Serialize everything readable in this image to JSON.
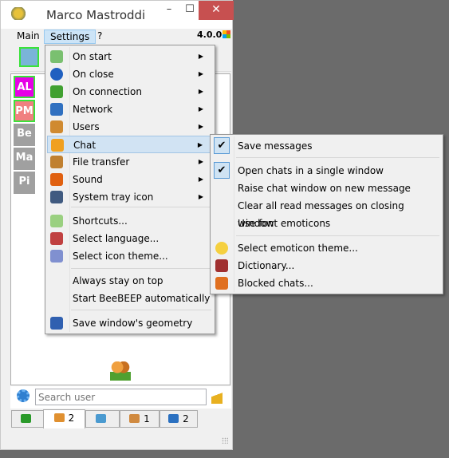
{
  "window": {
    "title": "Marco Mastroddi",
    "version": "4.0.0",
    "minimize": "–",
    "maximize": "☐",
    "close": "✕"
  },
  "menubar": [
    "Main",
    "Settings",
    "?"
  ],
  "users": [
    {
      "initials": "AL",
      "color": "#e600e6",
      "border": "#3ae23a"
    },
    {
      "initials": "PM",
      "color": "#f08080",
      "border": "#3ae23a"
    },
    {
      "initials": "Be",
      "color": "#a0a0a0"
    },
    {
      "initials": "Ma",
      "color": "#a0a0a0"
    },
    {
      "initials": "Pi",
      "color": "#a0a0a0"
    }
  ],
  "search": {
    "placeholder": "Search user"
  },
  "tabs": [
    {
      "icon": "monitor-icon",
      "count": ""
    },
    {
      "icon": "users-icon",
      "count": "2"
    },
    {
      "icon": "chat-bubbles-icon",
      "count": ""
    },
    {
      "icon": "groups-icon",
      "count": "1"
    },
    {
      "icon": "share-icon",
      "count": "2"
    }
  ],
  "settings_menu": {
    "submenus": [
      {
        "label": "On start",
        "icon": "gear-icon"
      },
      {
        "label": "On close",
        "icon": "power-icon"
      },
      {
        "label": "On connection",
        "icon": "connection-icon"
      },
      {
        "label": "Network",
        "icon": "network-icon"
      },
      {
        "label": "Users",
        "icon": "users-icon"
      },
      {
        "label": "Chat",
        "icon": "chat-icon",
        "highlighted": true
      },
      {
        "label": "File transfer",
        "icon": "file-transfer-icon"
      },
      {
        "label": "Sound",
        "icon": "bell-icon"
      },
      {
        "label": "System tray icon",
        "icon": "tray-icon"
      }
    ],
    "actions": [
      {
        "label": "Shortcuts...",
        "icon": "shortcuts-icon"
      },
      {
        "label": "Select language...",
        "icon": "language-icon"
      },
      {
        "label": "Select icon theme...",
        "icon": "icon-theme-icon"
      }
    ],
    "toggles": [
      "Always stay on top",
      "Start BeeBEEP automatically"
    ],
    "last": {
      "label": "Save window's geometry",
      "icon": "save-icon"
    }
  },
  "chat_menu": {
    "check1": {
      "label": "Save messages",
      "checked": true
    },
    "checks": [
      {
        "label": "Open chats in a single window",
        "checked": true
      },
      {
        "label": "Raise chat window on new message",
        "checked": false
      },
      {
        "label": "Clear all read messages on closing window",
        "checked": false
      },
      {
        "label": "Use font emoticons",
        "checked": false
      }
    ],
    "actions": [
      {
        "label": "Select emoticon theme...",
        "icon": "smiley-icon"
      },
      {
        "label": "Dictionary...",
        "icon": "dictionary-icon"
      },
      {
        "label": "Blocked chats...",
        "icon": "lock-icon"
      }
    ],
    "checkmark": "✔"
  },
  "arrow": "▶"
}
